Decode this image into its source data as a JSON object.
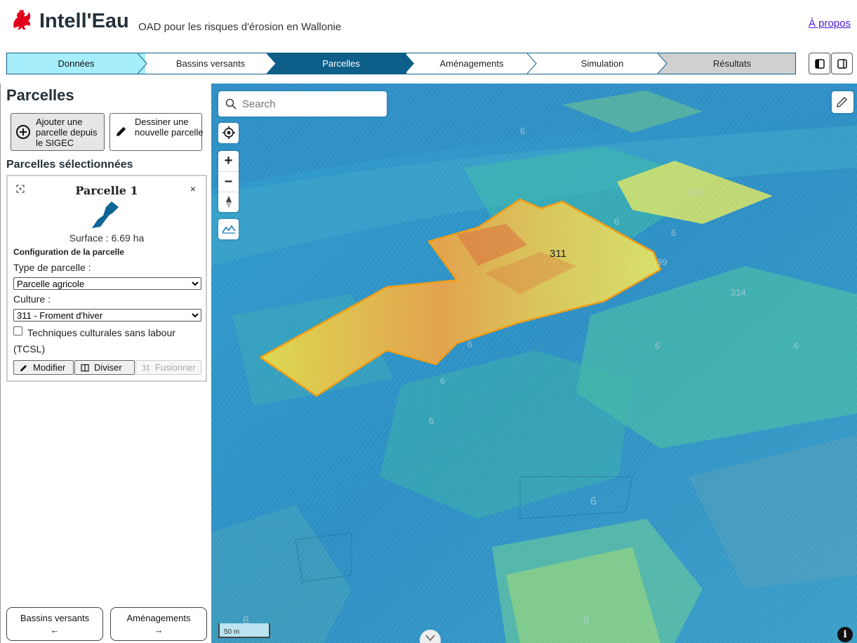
{
  "header": {
    "title": "Intell'Eau",
    "subtitle": "OAD pour les risques d'érosion en Wallonie",
    "about": "À propos",
    "logo_icon": "walloon-rooster-logo"
  },
  "stepper": {
    "steps": [
      {
        "label": "Données",
        "state": "done"
      },
      {
        "label": "Bassins versants",
        "state": "todo"
      },
      {
        "label": "Parcelles",
        "state": "active"
      },
      {
        "label": "Aménagements",
        "state": "todo"
      },
      {
        "label": "Simulation",
        "state": "todo"
      },
      {
        "label": "Résultats",
        "state": "disabled"
      }
    ],
    "colors": {
      "done": "#a6eefb",
      "active": "#0d5f8a",
      "todo": "#ffffff",
      "disabled": "#d0d0d0"
    }
  },
  "panel": {
    "title": "Parcelles",
    "add_button": "Ajouter une parcelle depuis le SIGEC",
    "draw_button": "Dessiner une nouvelle parcelle",
    "selected_title": "Parcelles sélectionnées",
    "card": {
      "title": "Parcelle 1",
      "close": "×",
      "surface": "Surface : 6.69 ha",
      "config_title": "Configuration de la parcelle",
      "type_label": "Type de parcelle :",
      "type_value": "Parcelle agricole",
      "culture_label": "Culture :",
      "culture_value": "311 - Froment d'hiver",
      "tcsl_label": "Techniques culturales sans labour (TCSL)",
      "tcsl_checked": false,
      "modify": "Modifier",
      "split": "Diviser",
      "merge": "Fusionner"
    },
    "prev_button": "Bassins versants",
    "prev_arrow": "←",
    "next_button": "Aménagements",
    "next_arrow": "→"
  },
  "map": {
    "search_placeholder": "Search",
    "zoom_in": "+",
    "zoom_out": "−",
    "scale": "50 m",
    "info": "i",
    "selected_parcel_label": "311",
    "other_labels": [
      "311",
      "6",
      "6",
      "99",
      "314",
      "6",
      "6",
      "6",
      "6",
      "6",
      "6",
      "6",
      "6",
      "6"
    ],
    "colors": {
      "parcel_outline": "#f39c12",
      "terrain_low": "#2a86c0",
      "terrain_mid": "#33b8a0",
      "parcel_fill": "#d9d85a"
    }
  }
}
